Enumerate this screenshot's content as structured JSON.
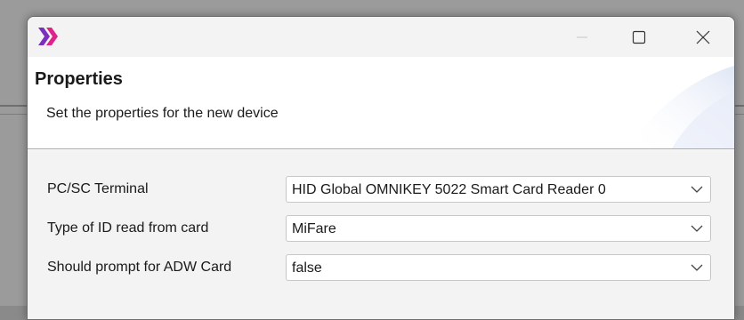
{
  "window": {
    "app_icon": "app-logo-icon",
    "controls": {
      "minimize": "minimize-icon",
      "maximize": "maximize-icon",
      "close": "close-icon"
    }
  },
  "header": {
    "title": "Properties",
    "subtitle": "Set the properties for the new device"
  },
  "form": {
    "rows": [
      {
        "label": "PC/SC Terminal",
        "value": "HID Global OMNIKEY 5022 Smart Card Reader 0"
      },
      {
        "label": "Type of ID read from card",
        "value": "MiFare"
      },
      {
        "label": "Should prompt for ADW Card",
        "value": "false"
      }
    ]
  },
  "colors": {
    "logo_purple": "#7b2fbe",
    "logo_magenta": "#e0238a",
    "window_bg": "#f3f3f3",
    "header_bg": "#ffffff"
  }
}
